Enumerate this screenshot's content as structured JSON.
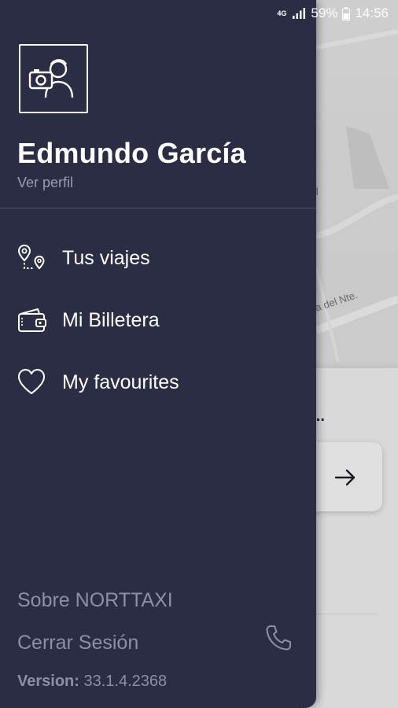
{
  "status_bar": {
    "network": "4G",
    "battery_percent": "59%",
    "time": "14:56"
  },
  "drawer": {
    "user_name": "Edmundo García",
    "view_profile": "Ver perfil",
    "menu": [
      {
        "label": "Tus viajes",
        "icon": "route-pin-icon"
      },
      {
        "label": "Mi Billetera",
        "icon": "wallet-icon"
      },
      {
        "label": "My favourites",
        "icon": "heart-icon"
      }
    ],
    "about": "Sobre NORTTAXI",
    "logout": "Cerrar Sesión",
    "version_label": "Version:",
    "version_value": "33.1.4.2368"
  },
  "background": {
    "map_label_1": "cal",
    "map_label_2": "utovía del Nte.",
    "sheet_title": "o...",
    "sheet_title_2": ".."
  },
  "colors": {
    "drawer_bg": "#2b2d45",
    "text_primary": "#ffffff",
    "text_muted": "#8d8fa8"
  }
}
